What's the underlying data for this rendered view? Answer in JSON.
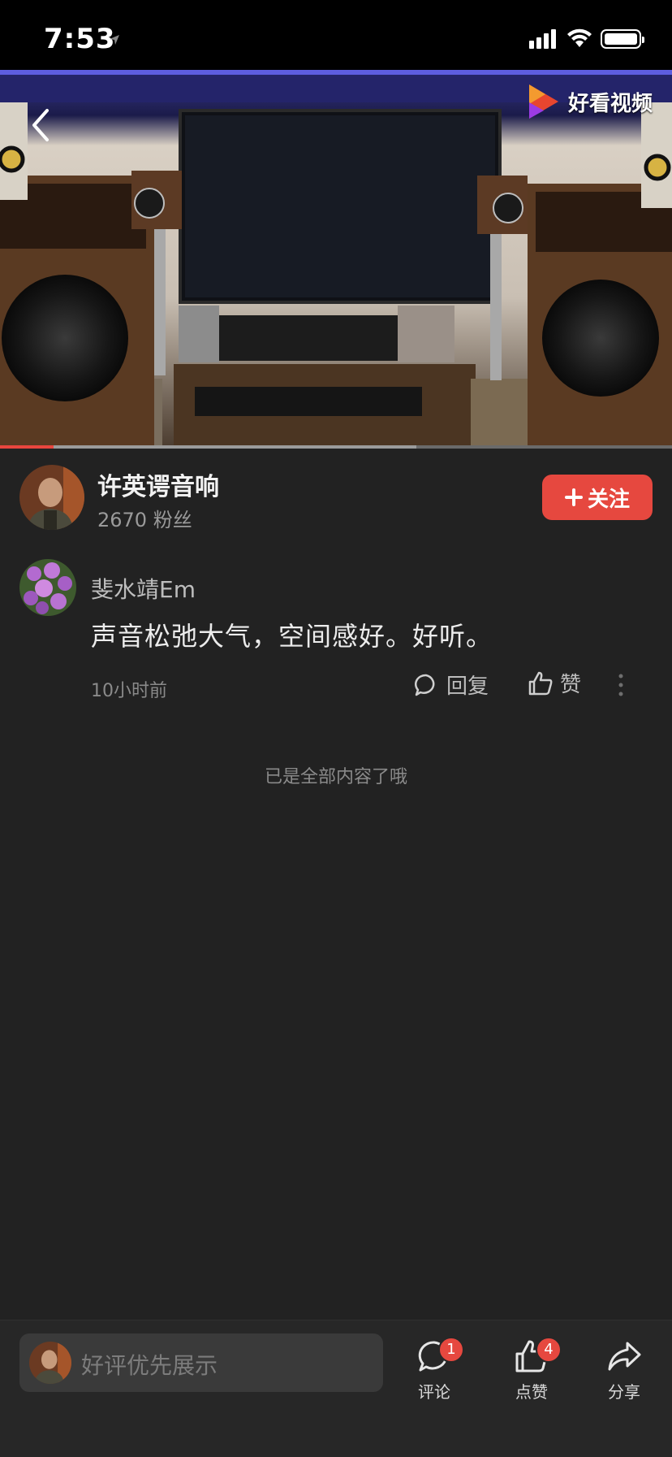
{
  "status_bar": {
    "time": "7:53"
  },
  "video": {
    "logo_text": "好看视频",
    "progress_played": 0.08,
    "progress_buffered": 0.62
  },
  "author": {
    "name": "许英谔音响",
    "fans": "2670 粉丝",
    "follow_label": "关注"
  },
  "comment": {
    "user": "斐水靖Em",
    "text": "声音松弛大气，空间感好。好听。",
    "time": "10小时前",
    "reply_label": "回复",
    "like_label": "赞"
  },
  "end_text": "已是全部内容了哦",
  "bottom_bar": {
    "input_placeholder": "好评优先展示",
    "comment_label": "评论",
    "comment_badge": "1",
    "like_label": "点赞",
    "like_badge": "4",
    "share_label": "分享"
  }
}
